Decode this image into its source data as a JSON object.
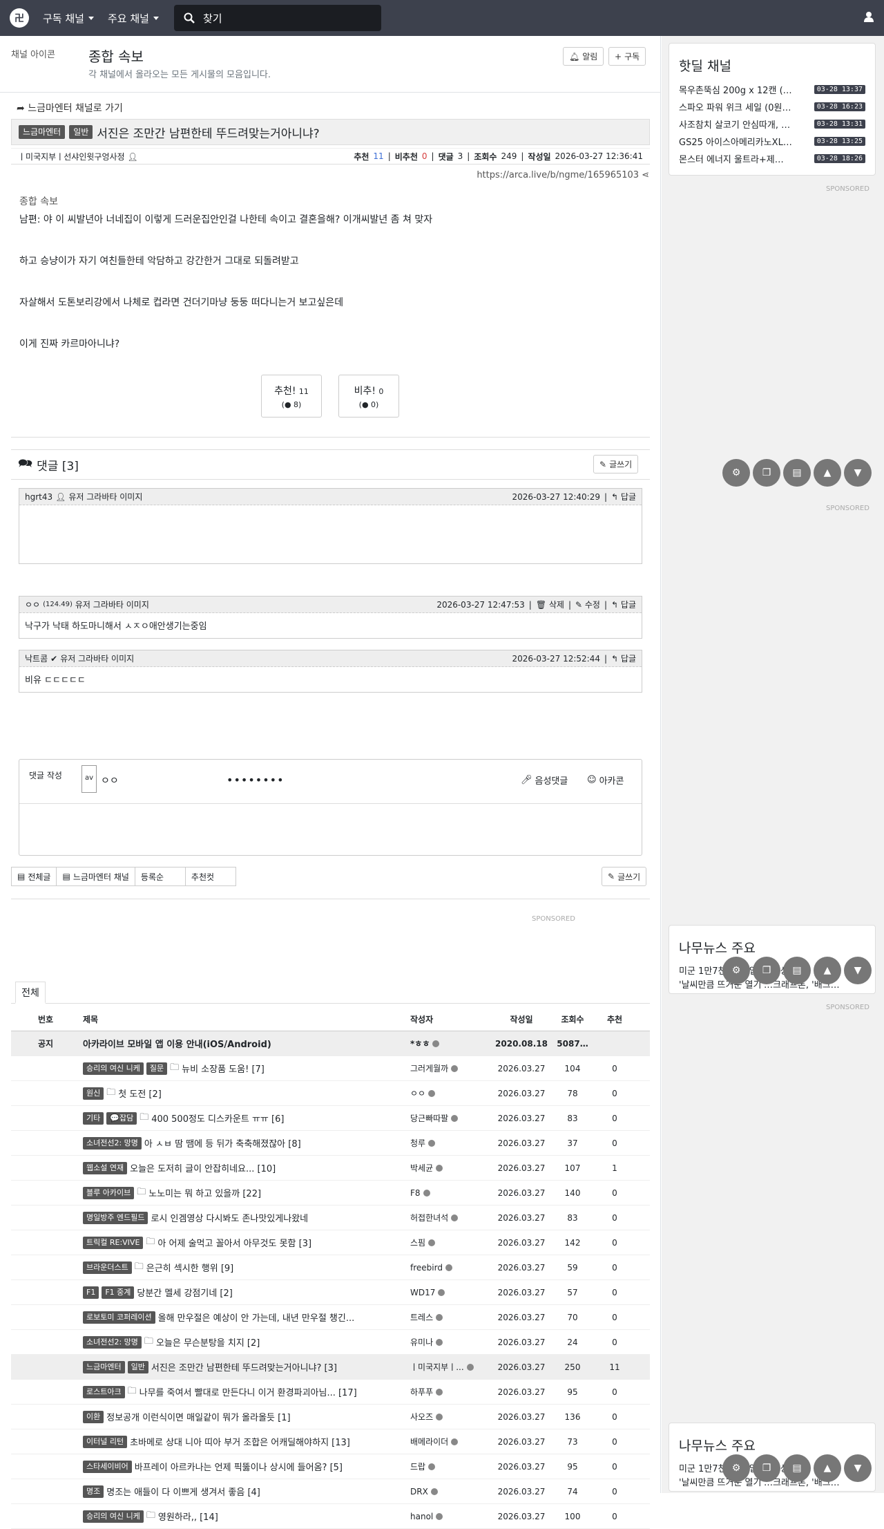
{
  "nav": {
    "logo": "卍",
    "menu1": "구독 채널",
    "menu2": "주요 채널",
    "search_placeholder": "찾기"
  },
  "board": {
    "icon_alt": "채널 아이콘",
    "title": "종합 속보",
    "desc": "각 채널에서 올라오는 모든 게시물의 모음입니다.",
    "alarm": "알림",
    "subscribe": "구독"
  },
  "article": {
    "back": "느금마엔터 채널로 가기",
    "badge1": "느금마엔터",
    "badge2": "일반",
    "title": "서진은 조만간 남편한테 뚜드려맞는거아니냐?",
    "author": "ㅣ미국지부ㅣ선샤인윗구엉사정",
    "rec_label": "추천",
    "rec": "11",
    "unrec_label": "비추천",
    "unrec": "0",
    "cmt_label": "댓글",
    "cmt": "3",
    "view_label": "조회수",
    "views": "249",
    "date_label": "작성일",
    "date": "2026-03-27 12:36:41",
    "url": "https://arca.live/b/ngme/165965103",
    "img_alt": "종합 속보",
    "paragraphs": [
      "남편: 야 이 씨발년아 너네집이 이렇게 드러운집안인걸 나한테 속이고 결혼을해? 이개씨발년 좀 쳐 맞자",
      "하고 승냥이가 자기 여친들한테 악담하고 강간한거 그대로 되돌려받고",
      "자살해서 도톤보리강에서 나체로 컵라면 건더기마냥 둥둥 떠다니는거 보고싶은데",
      "이게 진짜 카르마아니냐?"
    ],
    "vote_up": "추천!",
    "vote_up_count": "11",
    "vote_up_sub": "8",
    "vote_down": "비추!",
    "vote_down_count": "0",
    "vote_down_sub": "0"
  },
  "comments": {
    "heading": "댓글 [3]",
    "write": "글쓰기",
    "avatar_alt": "유저 그라바타 이미지",
    "items": [
      {
        "author": "hgrt43",
        "date": "2026-03-27 12:40:29",
        "reply": "답글",
        "body": ""
      },
      {
        "author": "ㅇㅇ",
        "ip": "(124.49)",
        "date": "2026-03-27 12:47:53",
        "del": "삭제",
        "edit": "수정",
        "reply": "답글",
        "body": "낙구가 낙태 하도마니해서 ㅅㅈㅇ애안생기는중임"
      },
      {
        "author": "낙트콤",
        "date": "2026-03-27 12:52:44",
        "reply": "답글",
        "body": "비유 ㄷㄷㄷㄷㄷ"
      }
    ],
    "form_label": "댓글 작성",
    "form_avatar": "av",
    "form_name": "ㅇㅇ",
    "form_pw": "••••••••",
    "voice": "음성댓글",
    "arcacon": "아카콘"
  },
  "listbtns": {
    "all": "전체글",
    "channel": "느금마엔터 채널",
    "reg": "등록순",
    "rec": "추천컷",
    "write": "글쓰기"
  },
  "sponsored": "SPONSORED",
  "list": {
    "tab": "전체",
    "headers": {
      "no": "번호",
      "title": "제목",
      "author": "작성자",
      "date": "작성일",
      "views": "조회수",
      "rec": "추천"
    },
    "notice": {
      "no": "공지",
      "title": "아카라이브 모바일 앱 이용 안내(iOS/Android)",
      "author": "*ㅎㅎ",
      "date": "2020.08.18",
      "views": "5087…",
      "rec": ""
    },
    "rows": [
      {
        "b1": "승리의 여신 니케",
        "b2": "질문",
        "img": true,
        "title": "뉴비 소장품 도움! [7]",
        "author": "그러게월까",
        "date": "2026.03.27",
        "views": "104",
        "rec": "0"
      },
      {
        "b1": "원신",
        "b2": "",
        "img": true,
        "title": "첫 도전 [2]",
        "author": "ㅇㅇ",
        "date": "2026.03.27",
        "views": "78",
        "rec": "0"
      },
      {
        "b1": "기타",
        "b2": "💬잡담",
        "img": true,
        "title": "400 500정도 디스카운트 ㅠㅠ [6]",
        "author": "당근빠따팔",
        "date": "2026.03.27",
        "views": "83",
        "rec": "0"
      },
      {
        "b1": "소녀전선2: 망명",
        "b2": "",
        "img": false,
        "title": "아 ㅅㅂ 땀 땜에 등 뒤가 축축해졌잖아 [8]",
        "author": "청루",
        "date": "2026.03.27",
        "views": "37",
        "rec": "0"
      },
      {
        "b1": "웹소설 연재",
        "b2": "",
        "img": false,
        "title": "오늘은 도저히 글이 안잡히네요... [10]",
        "author": "박세균",
        "date": "2026.03.27",
        "views": "107",
        "rec": "1"
      },
      {
        "b1": "블루 아카이브",
        "b2": "",
        "img": true,
        "title": "노노미는 뭐 하고 있을까 [22]",
        "author": "F8",
        "date": "2026.03.27",
        "views": "140",
        "rec": "0"
      },
      {
        "b1": "명일방주 엔드필드",
        "b2": "",
        "img": false,
        "title": "로시 인겜영상 다시봐도 존나맛있게나왔네",
        "author": "허접한녀석",
        "date": "2026.03.27",
        "views": "83",
        "rec": "0"
      },
      {
        "b1": "트릭컬 RE:VIVE",
        "b2": "",
        "img": true,
        "title": "아 어제 술먹고 꼴아서 아무것도 못함 [3]",
        "author": "스핌",
        "date": "2026.03.27",
        "views": "142",
        "rec": "0"
      },
      {
        "b1": "브라운더스트",
        "b2": "",
        "img": true,
        "title": "은근히 섹시한 행위 [9]",
        "author": "freebird",
        "date": "2026.03.27",
        "views": "59",
        "rec": "0"
      },
      {
        "b1": "F1",
        "b2": "F1 중계",
        "img": false,
        "title": "당분간 멜세 강점기네 [2]",
        "author": "WD17",
        "date": "2026.03.27",
        "views": "57",
        "rec": "0"
      },
      {
        "b1": "로보토미 코퍼레이션",
        "b2": "",
        "img": false,
        "title": "올해 만우절은 예상이 안 가는데, 내년 만우절 챙긴...",
        "author": "트레스",
        "date": "2026.03.27",
        "views": "70",
        "rec": "0"
      },
      {
        "b1": "소녀전선2: 망명",
        "b2": "",
        "img": true,
        "title": "오늘은 무슨분탕을 치지 [2]",
        "author": "유미나",
        "date": "2026.03.27",
        "views": "24",
        "rec": "0"
      },
      {
        "b1": "느금마엔터",
        "b2": "일반",
        "img": false,
        "title": "서진은 조만간 남편한테 뚜드려맞는거아니냐? [3]",
        "author": "ㅣ미국지부ㅣ...",
        "date": "2026.03.27",
        "views": "250",
        "rec": "11",
        "hl": true
      },
      {
        "b1": "로스트아크",
        "b2": "",
        "img": true,
        "title": "나무를 죽여서 빨대로 만든다니 이거 환경파괴아님... [17]",
        "author": "하푸푸",
        "date": "2026.03.27",
        "views": "95",
        "rec": "0"
      },
      {
        "b1": "이환",
        "b2": "",
        "img": false,
        "title": "정보공개 이런식이면 매일같이 뭐가 올라올듯 [1]",
        "author": "사오즈",
        "date": "2026.03.27",
        "views": "136",
        "rec": "0"
      },
      {
        "b1": "이터널 리턴",
        "b2": "",
        "img": false,
        "title": "초바메로 상대 니아 띠아 부거 조합은 어캐딜해야하지 [13]",
        "author": "배메라이더",
        "date": "2026.03.27",
        "views": "73",
        "rec": "0"
      },
      {
        "b1": "스타세이비어",
        "b2": "",
        "img": false,
        "title": "바프레이 아르카나는 언제 픽뚫이나 상시에 들어옴? [5]",
        "author": "드랍",
        "date": "2026.03.27",
        "views": "95",
        "rec": "0"
      },
      {
        "b1": "명조",
        "b2": "",
        "img": false,
        "title": "명조는 애들이 다 이쁘게 생겨서 좋음 [4]",
        "author": "DRX",
        "date": "2026.03.27",
        "views": "74",
        "rec": "0"
      },
      {
        "b1": "승리의 여신 니케",
        "b2": "",
        "img": true,
        "title": "영원하라,, [14]",
        "author": "hanol",
        "date": "2026.03.27",
        "views": "100",
        "rec": "0"
      }
    ]
  },
  "sidebar": {
    "hotdeal_title": "핫딜 채널",
    "hotdeal": [
      {
        "title": "목우촌뚝심 200g x 12캔 (…",
        "time": "03-28 13:37"
      },
      {
        "title": "스파오 파워 위크 세일 (0원…",
        "time": "03-28 16:23"
      },
      {
        "title": "사조참치 살코기 안심따개, …",
        "time": "03-28 13:31"
      },
      {
        "title": "GS25 아이스아메리카노XL…",
        "time": "03-28 13:25"
      },
      {
        "title": "몬스터 에너지 울트라+제…",
        "time": "03-28 18:26"
      }
    ],
    "news_title": "나무뉴스 주요",
    "news": [
      "미군 1만7천 … 투입 … 지상군 …",
      "'날씨만큼 뜨거운 열기'…크래프톤, '배그…"
    ]
  }
}
